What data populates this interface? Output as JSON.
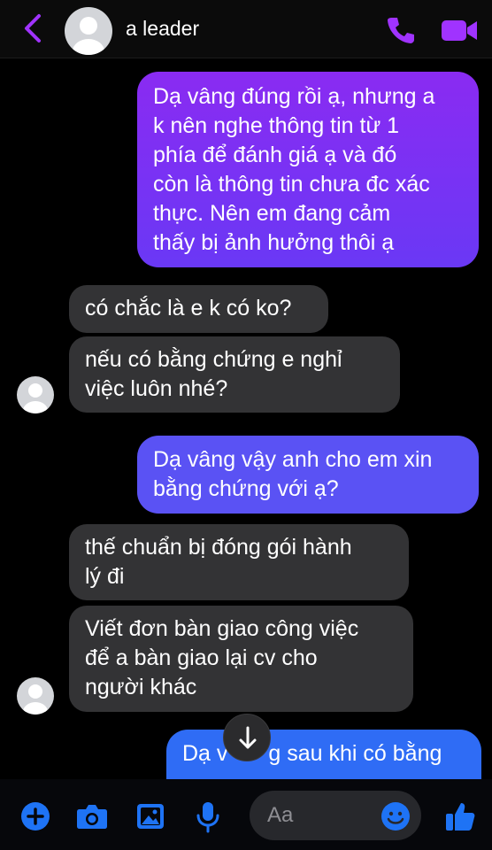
{
  "header": {
    "contact_name": "a leader"
  },
  "messages": [
    {
      "direction": "outgoing",
      "lines": [
        "Dạ vâng đúng rồi ạ, nhưng a",
        "k nên nghe thông tin từ 1",
        "phía để đánh giá ạ và đó",
        "còn là thông tin chưa đc xác",
        "thực. Nên em đang cảm",
        "thấy bị ảnh hưởng thôi ạ"
      ]
    },
    {
      "direction": "incoming",
      "lines": [
        "có chắc là e k có ko?"
      ]
    },
    {
      "direction": "incoming",
      "lines": [
        "nếu  có bằng chứng e nghỉ",
        "việc luôn nhé?"
      ]
    },
    {
      "direction": "outgoing",
      "lines": [
        "Dạ vâng vậy anh cho em xin",
        "bằng chứng với ạ?"
      ]
    },
    {
      "direction": "incoming",
      "lines": [
        "thế chuẩn bị đóng gói hành",
        "lý đi"
      ]
    },
    {
      "direction": "incoming",
      "lines": [
        "Viết đơn bàn giao công việc",
        "để a bàn giao lại cv cho",
        "người khác"
      ]
    },
    {
      "direction": "outgoing",
      "lines": [
        "Dạ v",
        "g sau khi có bằng"
      ]
    }
  ],
  "composer": {
    "placeholder": "Aa"
  },
  "icons": {
    "back": "chevron-left-icon",
    "call": "phone-icon",
    "video": "video-camera-icon",
    "scroll": "arrow-down-icon",
    "plus": "plus-circle-icon",
    "camera": "camera-icon",
    "gallery": "image-icon",
    "mic": "microphone-icon",
    "emoji": "emoji-icon",
    "like": "thumbs-up-icon"
  },
  "colors": {
    "accent_purple": "#a033ff",
    "outgoing_top": "#8a2bf2",
    "outgoing_mid": "#5a52f4",
    "outgoing_bottom": "#2f6cf5",
    "incoming": "#333335",
    "toolbar_blue": "#1e73f5"
  }
}
